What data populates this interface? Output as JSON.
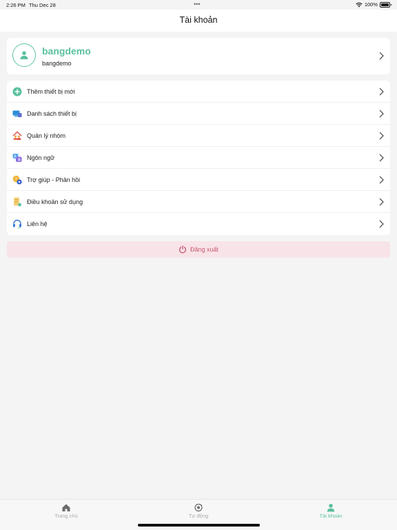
{
  "status_bar": {
    "time": "2:26 PM",
    "date": "Thu Dec 28",
    "battery": "100%"
  },
  "header": {
    "title": "Tài khoản"
  },
  "profile": {
    "name": "bangdemo",
    "username": "bangdemo",
    "icon": "user-icon"
  },
  "menu": {
    "items": [
      {
        "label": "Thêm thiết bị mới",
        "icon": "add-circle-icon"
      },
      {
        "label": "Danh sách thiết bị",
        "icon": "devices-icon"
      },
      {
        "label": "Quản lý nhóm",
        "icon": "group-icon"
      },
      {
        "label": "Ngôn ngữ",
        "icon": "language-icon"
      },
      {
        "label": "Trợ giúp - Phản hồi",
        "icon": "help-icon"
      },
      {
        "label": "Điều khoản sử dụng",
        "icon": "terms-icon"
      },
      {
        "label": "Liên hệ",
        "icon": "headset-icon"
      }
    ]
  },
  "logout": {
    "label": "Đăng xuất",
    "icon": "power-icon"
  },
  "tabbar": {
    "tabs": [
      {
        "label": "Trang chủ",
        "icon": "home-icon",
        "active": false
      },
      {
        "label": "Tự động",
        "icon": "automation-icon",
        "active": false
      },
      {
        "label": "Tài khoản",
        "icon": "account-icon",
        "active": true
      }
    ]
  },
  "colors": {
    "accent": "#5bc0a0",
    "logout_bg": "#f8e4e8",
    "logout_text": "#c95572",
    "background": "#f4f4f4"
  }
}
